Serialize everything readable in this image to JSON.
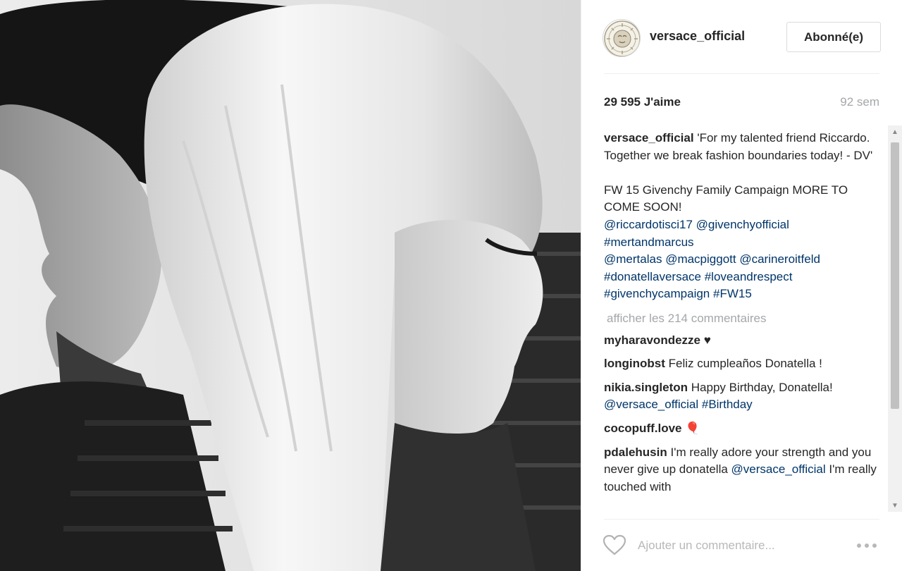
{
  "post": {
    "author": {
      "username": "versace_official",
      "follow_label": "Abonné(e)"
    },
    "likes": "29 595 J'aime",
    "time": "92 sem",
    "caption": {
      "username": "versace_official",
      "line1": "'For my talented friend Riccardo. Together we break fashion boundaries today! - DV'",
      "line2": "FW 15 Givenchy Family Campaign MORE TO COME SOON!",
      "tags": [
        "@riccardotisci17",
        "@givenchyofficial",
        "#mertandmarcus",
        "@mertalas",
        "@macpiggott",
        "@carineroitfeld",
        "#donatellaversace",
        "#loveandrespect",
        "#givenchycampaign",
        "#FW15"
      ]
    },
    "view_all_comments": "afficher les 214 commentaires",
    "comments": [
      {
        "username": "myharavondezze",
        "text": "♥"
      },
      {
        "username": "longinobst",
        "text": "Feliz cumpleaños Donatella !"
      },
      {
        "username": "nikia.singleton",
        "text": "Happy Birthday, Donatella!",
        "tags": [
          "@versace_official",
          "#Birthday"
        ]
      },
      {
        "username": "cocopuff.love",
        "text": "🎈"
      },
      {
        "username": "pdalehusin",
        "text": "I'm really adore your strength and you never give up donatella",
        "tags": [
          "@versace_official"
        ],
        "text2": "I'm really touched with"
      }
    ],
    "add_comment_placeholder": "Ajouter un commentaire..."
  },
  "icons": {
    "avatar": "medusa-logo-icon",
    "like": "heart-icon",
    "options": "more-options-icon",
    "scroll_up": "chevron-up-icon",
    "scroll_down": "chevron-down-icon"
  },
  "colors": {
    "link": "#003569",
    "muted": "#a5a7aa",
    "text": "#262626",
    "border": "#dbdbdb"
  }
}
